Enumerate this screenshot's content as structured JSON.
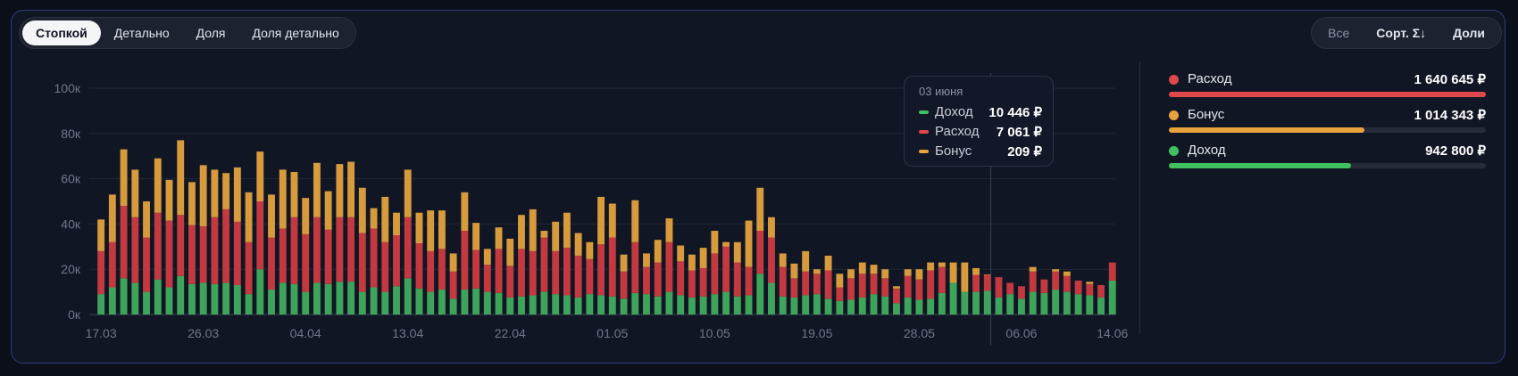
{
  "tabs": [
    {
      "label": "Стопкой",
      "active": true
    },
    {
      "label": "Детально"
    },
    {
      "label": "Доля"
    },
    {
      "label": "Доля детально"
    }
  ],
  "controls": {
    "all_label": "Все",
    "sort_label": "Сорт. Σ↓",
    "shares_label": "Доли"
  },
  "colors": {
    "income": "#3fa45b",
    "expense": "#c2393f",
    "bonus": "#d79a3c",
    "grid": "#1f2636"
  },
  "legend": [
    {
      "name": "Расход",
      "value": "1 640 645 ₽",
      "color": "#e0494c",
      "share": 1.0
    },
    {
      "name": "Бонус",
      "value": "1 014 343 ₽",
      "color": "#e8a23e",
      "share": 0.618
    },
    {
      "name": "Доход",
      "value": "942 800 ₽",
      "color": "#3fc15f",
      "share": 0.575
    }
  ],
  "tooltip": {
    "date": "03 июня",
    "rows": [
      {
        "name": "Доход",
        "value": "10 446 ₽",
        "color": "#3fc15f"
      },
      {
        "name": "Расход",
        "value": "7 061 ₽",
        "color": "#e0494c"
      },
      {
        "name": "Бонус",
        "value": "209 ₽",
        "color": "#e8a23e"
      }
    ]
  },
  "chart_data": {
    "type": "bar",
    "stacked": true,
    "ylim": [
      0,
      100000
    ],
    "yticks": [
      0,
      20000,
      40000,
      60000,
      80000,
      100000
    ],
    "ytick_labels": [
      "0к",
      "20к",
      "40к",
      "60к",
      "80к",
      "100к"
    ],
    "xtick_labels": [
      "17.03",
      "26.03",
      "04.04",
      "13.04",
      "22.04",
      "01.05",
      "10.05",
      "19.05",
      "28.05",
      "06.06",
      "14.06"
    ],
    "xtick_days": [
      0,
      9,
      18,
      27,
      36,
      45,
      54,
      63,
      72,
      81,
      89
    ],
    "start_label": "17.03",
    "hover_index": 78,
    "series": [
      {
        "name": "Доход",
        "values": [
          9000,
          12000,
          16000,
          14000,
          10000,
          15500,
          12000,
          17000,
          13500,
          14000,
          13500,
          14000,
          13000,
          9000,
          20000,
          11000,
          14000,
          13500,
          10000,
          14000,
          13500,
          14500,
          14500,
          10000,
          12000,
          10000,
          12500,
          16000,
          11500,
          10000,
          11000,
          7000,
          11000,
          11500,
          10000,
          9500,
          7500,
          8000,
          8500,
          10000,
          9000,
          8500,
          7500,
          9000,
          8500,
          8000,
          7000,
          9500,
          9000,
          8000,
          10000,
          8500,
          7500,
          8000,
          9000,
          10000,
          8000,
          8500,
          18000,
          14000,
          8000,
          7500,
          8500,
          9000,
          7000,
          6000,
          6500,
          7500,
          9000,
          8000,
          5000,
          7500,
          6500,
          7000,
          9500,
          14000,
          10000,
          10000,
          10446,
          7500,
          9000,
          7000,
          10000,
          9500,
          11000,
          10000,
          9000,
          8500,
          7500,
          15000
        ]
      },
      {
        "name": "Расход",
        "values": [
          19000,
          20000,
          32000,
          29000,
          24000,
          29500,
          29500,
          27000,
          26000,
          25000,
          29500,
          32500,
          28000,
          23000,
          30000,
          23000,
          24000,
          29500,
          25500,
          29000,
          24000,
          28500,
          28500,
          26000,
          26000,
          22000,
          22500,
          27000,
          20000,
          18000,
          18000,
          12000,
          26000,
          17000,
          12000,
          19500,
          14000,
          21000,
          19500,
          24000,
          19000,
          21000,
          18500,
          15500,
          22500,
          26000,
          12000,
          22500,
          12000,
          15000,
          22000,
          15000,
          12000,
          12500,
          18000,
          20000,
          15000,
          12500,
          19000,
          20000,
          13000,
          8500,
          10500,
          9000,
          12500,
          6000,
          9500,
          10500,
          9000,
          8000,
          6500,
          9500,
          9000,
          12500,
          11500,
          0,
          0,
          7500,
          7061,
          9000,
          5000,
          5500,
          9000,
          6000,
          8000,
          7000,
          6000,
          5000,
          5500,
          8000
        ]
      },
      {
        "name": "Бонус",
        "values": [
          14000,
          21000,
          25000,
          21000,
          16000,
          24000,
          18000,
          33000,
          19000,
          27000,
          21000,
          16000,
          24000,
          22000,
          22000,
          19000,
          26000,
          20000,
          16000,
          24000,
          17000,
          23500,
          24500,
          20000,
          9000,
          20000,
          10000,
          21000,
          13500,
          18000,
          17000,
          8000,
          17000,
          12000,
          7000,
          9500,
          12000,
          15000,
          18500,
          3000,
          13000,
          15500,
          10000,
          7500,
          21000,
          15000,
          7500,
          18500,
          6000,
          10000,
          10500,
          7000,
          7000,
          9000,
          10000,
          2000,
          9000,
          20500,
          19000,
          9000,
          6000,
          6500,
          9000,
          2000,
          6500,
          6000,
          4000,
          5000,
          4000,
          4000,
          1000,
          3000,
          4500,
          3500,
          2000,
          9000,
          13000,
          3000,
          209,
          0,
          0,
          0,
          2000,
          0,
          1000,
          2000,
          0,
          1000,
          0,
          0
        ]
      }
    ]
  }
}
